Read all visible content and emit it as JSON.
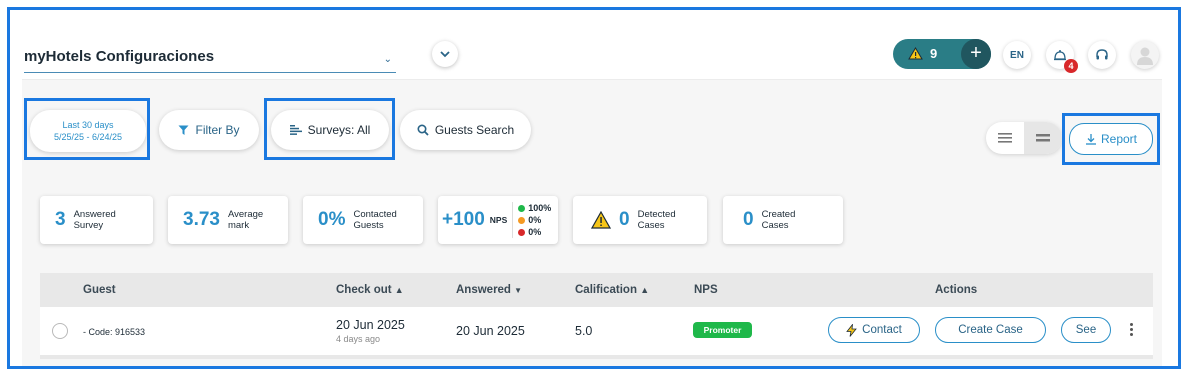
{
  "header": {
    "hotel_title": "myHotels Configuraciones",
    "alert_count": "9",
    "add_label": "+",
    "language": "EN",
    "notification_count": "4"
  },
  "filters": {
    "date_range_label": "Last 30 days",
    "date_range_value": "5/25/25 - 6/24/25",
    "filter_by": "Filter By",
    "surveys": "Surveys: All",
    "guests_search": "Guests Search",
    "report": "Report"
  },
  "kpis": {
    "answered": {
      "value": "3",
      "label1": "Answered",
      "label2": "Survey"
    },
    "average": {
      "value": "3.73",
      "label1": "Average",
      "label2": "mark"
    },
    "contacted": {
      "value": "0%",
      "label1": "Contacted",
      "label2": "Guests"
    },
    "nps": {
      "value": "+100",
      "label": "NPS",
      "promoters": "100%",
      "passives": "0%",
      "detractors": "0%"
    },
    "detected": {
      "value": "0",
      "label1": "Detected",
      "label2": "Cases"
    },
    "created": {
      "value": "0",
      "label1": "Created",
      "label2": "Cases"
    }
  },
  "table": {
    "headers": {
      "guest": "Guest",
      "checkout": "Check out",
      "answered": "Answered",
      "calification": "Calification",
      "nps": "NPS",
      "actions": "Actions"
    },
    "rows": [
      {
        "code": "- Code: 916533",
        "checkout_date": "20 Jun 2025",
        "checkout_ago": "4 days ago",
        "answered": "20 Jun 2025",
        "calification": "5.0",
        "nps": "Promoter",
        "contact": "Contact",
        "create_case": "Create Case",
        "see": "See"
      }
    ]
  },
  "colors": {
    "accent": "#2a8fc8",
    "alert_pill": "#2a7d86",
    "promoter": "#1fb84a",
    "highlight": "#1a78e0"
  }
}
